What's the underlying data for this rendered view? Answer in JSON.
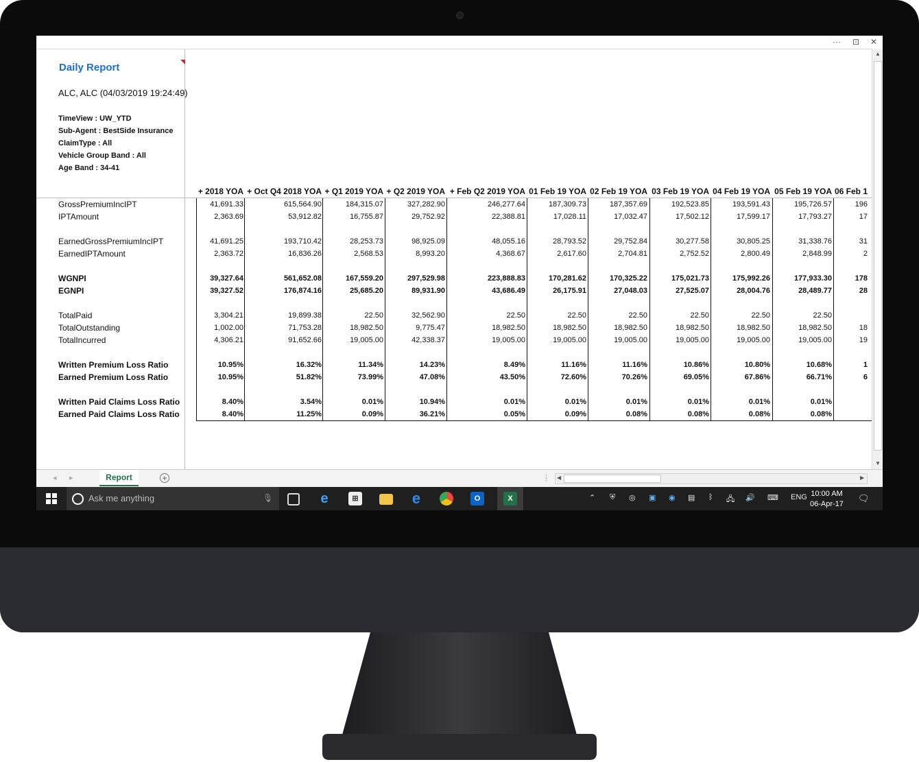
{
  "window": {
    "controls": [
      "···",
      "⊡",
      "✕"
    ]
  },
  "report": {
    "title": "Daily Report",
    "subtitle": "ALC, ALC (04/03/2019 19:24:49)",
    "filters": [
      "TimeView : UW_YTD",
      "Sub-Agent : BestSide Insurance",
      "ClaimType : All",
      "Vehicle Group Band : All",
      "Age Band : 34-41"
    ]
  },
  "columns": [
    "+ 2018 YOA",
    "+ Oct Q4 2018 YOA",
    "+ Q1 2019 YOA",
    "+ Q2 2019 YOA",
    "+ Feb Q2 2019 YOA",
    "01 Feb 19 YOA",
    "02 Feb 19 YOA",
    "03 Feb 19 YOA",
    "04 Feb 19 YOA",
    "05 Feb 19 YOA",
    "06 Feb 1"
  ],
  "rows": [
    {
      "label": "GrossPremiumIncIPT",
      "bold": false,
      "values": [
        "41,691.33",
        "615,564.90",
        "184,315.07",
        "327,282.90",
        "246,277.64",
        "187,309.73",
        "187,357.69",
        "192,523.85",
        "193,591.43",
        "195,726.57",
        "196"
      ]
    },
    {
      "label": "IPTAmount",
      "bold": false,
      "values": [
        "2,363.69",
        "53,912.82",
        "16,755.87",
        "29,752.92",
        "22,388.81",
        "17,028.11",
        "17,032.47",
        "17,502.12",
        "17,599.17",
        "17,793.27",
        "17"
      ]
    },
    {
      "label": "EarnedGrossPremiumIncIPT",
      "bold": false,
      "values": [
        "41,691.25",
        "193,710.42",
        "28,253.73",
        "98,925.09",
        "48,055.16",
        "28,793.52",
        "29,752.84",
        "30,277.58",
        "30,805.25",
        "31,338.76",
        "31"
      ]
    },
    {
      "label": "EarnedIPTAmount",
      "bold": false,
      "values": [
        "2,363.72",
        "16,836.26",
        "2,568.53",
        "8,993.20",
        "4,368.67",
        "2,617.60",
        "2,704.81",
        "2,752.52",
        "2,800.49",
        "2,848.99",
        "2"
      ]
    },
    {
      "label": "WGNPI",
      "bold": true,
      "values": [
        "39,327.64",
        "561,652.08",
        "167,559.20",
        "297,529.98",
        "223,888.83",
        "170,281.62",
        "170,325.22",
        "175,021.73",
        "175,992.26",
        "177,933.30",
        "178"
      ]
    },
    {
      "label": "EGNPI",
      "bold": true,
      "values": [
        "39,327.52",
        "176,874.16",
        "25,685.20",
        "89,931.90",
        "43,686.49",
        "26,175.91",
        "27,048.03",
        "27,525.07",
        "28,004.76",
        "28,489.77",
        "28"
      ]
    },
    {
      "label": "TotalPaid",
      "bold": false,
      "values": [
        "3,304.21",
        "19,899.38",
        "22.50",
        "32,562.90",
        "22.50",
        "22.50",
        "22.50",
        "22.50",
        "22.50",
        "22.50",
        ""
      ]
    },
    {
      "label": "TotalOutstanding",
      "bold": false,
      "values": [
        "1,002.00",
        "71,753.28",
        "18,982.50",
        "9,775.47",
        "18,982.50",
        "18,982.50",
        "18,982.50",
        "18,982.50",
        "18,982.50",
        "18,982.50",
        "18"
      ]
    },
    {
      "label": "TotalIncurred",
      "bold": false,
      "values": [
        "4,306.21",
        "91,652.66",
        "19,005.00",
        "42,338.37",
        "19,005.00",
        "19,005.00",
        "19,005.00",
        "19,005.00",
        "19,005.00",
        "19,005.00",
        "19"
      ]
    },
    {
      "label": "Written Premium Loss Ratio",
      "bold": true,
      "values": [
        "10.95%",
        "16.32%",
        "11.34%",
        "14.23%",
        "8.49%",
        "11.16%",
        "11.16%",
        "10.86%",
        "10.80%",
        "10.68%",
        "1"
      ]
    },
    {
      "label": "Earned Premium Loss Ratio",
      "bold": true,
      "values": [
        "10.95%",
        "51.82%",
        "73.99%",
        "47.08%",
        "43.50%",
        "72.60%",
        "70.26%",
        "69.05%",
        "67.86%",
        "66.71%",
        "6"
      ]
    },
    {
      "label": "Written Paid Claims Loss Ratio",
      "bold": true,
      "values": [
        "8.40%",
        "3.54%",
        "0.01%",
        "10.94%",
        "0.01%",
        "0.01%",
        "0.01%",
        "0.01%",
        "0.01%",
        "0.01%",
        ""
      ]
    },
    {
      "label": "Earned Paid Claims Loss Ratio",
      "bold": true,
      "values": [
        "8.40%",
        "11.25%",
        "0.09%",
        "36.21%",
        "0.05%",
        "0.09%",
        "0.08%",
        "0.08%",
        "0.08%",
        "0.08%",
        ""
      ]
    }
  ],
  "sheet": {
    "tab_label": "Report",
    "add_label": "+"
  },
  "taskbar": {
    "search_placeholder": "Ask me anything",
    "language": "ENG",
    "time": "10:00 AM",
    "date": "06-Apr-17"
  }
}
